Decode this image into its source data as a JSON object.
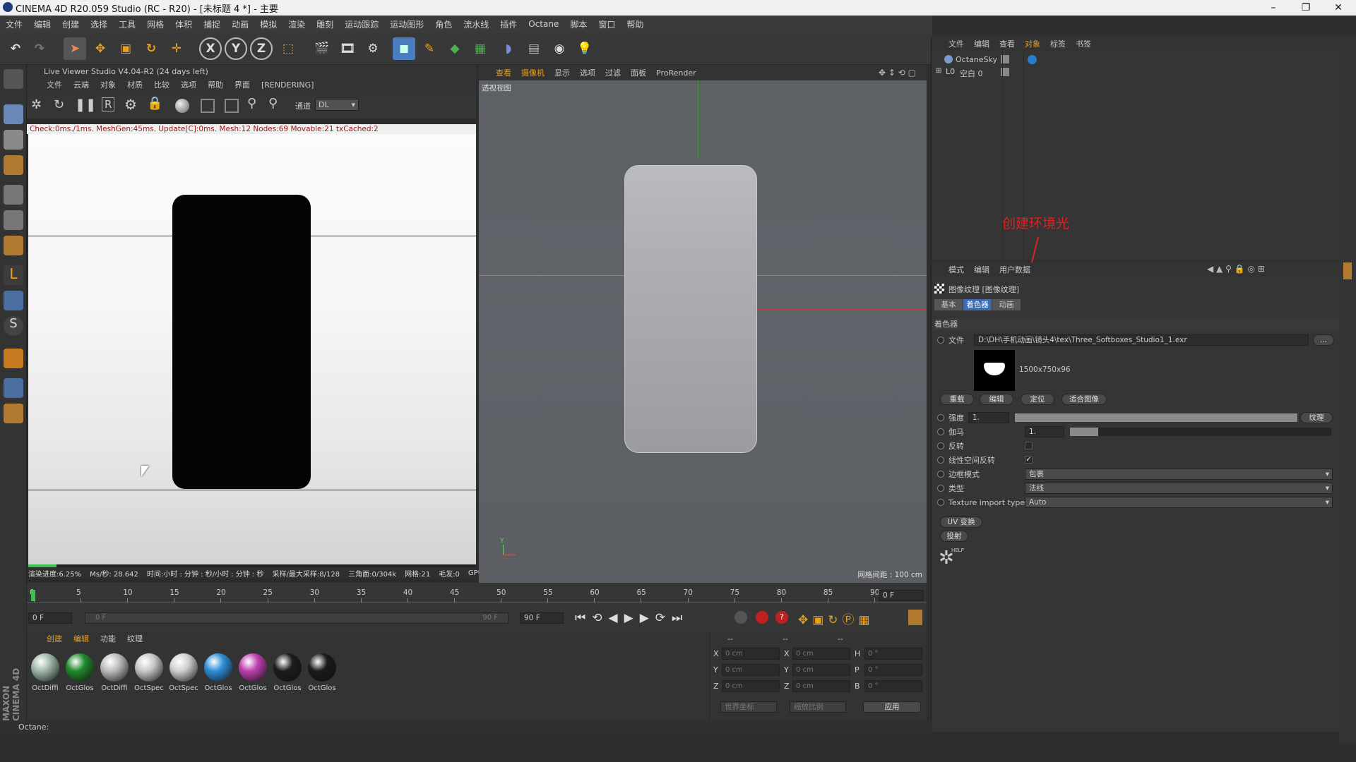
{
  "window": {
    "title": "CINEMA 4D R20.059 Studio (RC - R20) - [未标题 4 *] - 主要"
  },
  "menubar": [
    "文件",
    "编辑",
    "创建",
    "选择",
    "工具",
    "网格",
    "体积",
    "捕捉",
    "动画",
    "模拟",
    "渲染",
    "雕刻",
    "运动跟踪",
    "运动图形",
    "角色",
    "流水线",
    "插件",
    "Octane",
    "脚本",
    "窗口",
    "帮助"
  ],
  "live_viewer": {
    "title": "Live Viewer Studio V4.04-R2 (24 days left)",
    "menu": [
      "文件",
      "云端",
      "对象",
      "材质",
      "比较",
      "选项",
      "帮助",
      "界面",
      "[RENDERING]"
    ],
    "channel_label": "通道",
    "channel_value": "DL",
    "status": "Check:0ms./1ms. MeshGen:45ms. Update[C]:0ms. Mesh:12 Nodes:69 Movable:21 txCached:2",
    "progress": 0.0625,
    "bottom_stats": [
      "渲染进度:6.25%",
      "Ms/秒: 28.642",
      "时间:小时 : 分钟 : 秒/小时 : 分钟 : 秒",
      "采样/最大采样:8/128",
      "三角面:0/304k",
      "网格:21",
      "毛发:0",
      "GPU"
    ]
  },
  "viewport": {
    "menu": [
      "查看",
      "摄像机",
      "显示",
      "选项",
      "过滤",
      "面板",
      "ProRender"
    ],
    "view_name": "透视视图",
    "grid_info": "网格间距 : 100 cm",
    "axis_y": "Y"
  },
  "object_manager": {
    "menu": [
      "文件",
      "编辑",
      "查看",
      "对象",
      "标签",
      "书签"
    ],
    "items": [
      {
        "name": "OctaneSky"
      },
      {
        "name": "空白 0"
      }
    ]
  },
  "annotation": {
    "text": "创建环境光"
  },
  "attributes": {
    "menu": [
      "模式",
      "编辑",
      "用户数据"
    ],
    "title": "图像纹理 [图像纹理]",
    "tabs": [
      "基本",
      "着色器",
      "动画"
    ],
    "section": "着色器",
    "file_label": "文件",
    "file_path": "D:\\DH\\手机动画\\镜头4\\tex\\Three_Softboxes_Studio1_1.exr",
    "file_btn": "...",
    "image_info": "1500x750x96",
    "buttons": [
      "重载",
      "编辑",
      "定位",
      "适合图像"
    ],
    "power_label": "强度",
    "power_value": "1.",
    "texture_btn": "纹理",
    "gamma_label": "伽马",
    "gamma_value": "1.",
    "invert_label": "反转",
    "linear_label": "线性空间反转",
    "border_label": "边框模式",
    "border_value": "包裹",
    "type_label": "类型",
    "type_value": "法线",
    "import_label": "Texture import type",
    "import_value": "Auto",
    "uv_btn": "UV 变换",
    "proj_btn": "投射",
    "help_label": "HELP"
  },
  "timeline": {
    "ticks": [
      "0",
      "5",
      "10",
      "15",
      "20",
      "25",
      "30",
      "35",
      "40",
      "45",
      "50",
      "55",
      "60",
      "65",
      "70",
      "75",
      "80",
      "85",
      "90"
    ],
    "frame_field": "0 F",
    "start": "0 F",
    "range_start": "0 F",
    "range_end": "90 F",
    "end": "90 F"
  },
  "materials": {
    "menu": [
      "创建",
      "编辑",
      "功能",
      "纹理"
    ],
    "items": [
      {
        "name": "OctDiffi",
        "color": "#9fb8a8"
      },
      {
        "name": "OctGlos",
        "color": "#1f8a2c"
      },
      {
        "name": "OctDiffi",
        "color": "#bdbdbd"
      },
      {
        "name": "OctSpec",
        "color": "#c9c9c9"
      },
      {
        "name": "OctSpec",
        "color": "#d0d0d0"
      },
      {
        "name": "OctGlos",
        "color": "#2d8fd8"
      },
      {
        "name": "OctGlos",
        "color": "#c040b0"
      },
      {
        "name": "OctGlos",
        "color": "#1c1c1c"
      },
      {
        "name": "OctGlos",
        "color": "#1a1a1a"
      }
    ]
  },
  "coords": {
    "hdr": [
      "--",
      "--",
      "--"
    ],
    "rows": [
      {
        "a": "X",
        "av": "0 cm",
        "b": "X",
        "bv": "0 cm",
        "c": "H",
        "cv": "0 °"
      },
      {
        "a": "Y",
        "av": "0 cm",
        "b": "Y",
        "bv": "0 cm",
        "c": "P",
        "cv": "0 °"
      },
      {
        "a": "Z",
        "av": "0 cm",
        "b": "Z",
        "bv": "0 cm",
        "c": "B",
        "cv": "0 °"
      }
    ],
    "world": "世界坐标",
    "scale": "缩放比例",
    "apply": "应用"
  },
  "statusbar": {
    "text": "Octane:"
  },
  "brand": "MAXON CINEMA 4D"
}
